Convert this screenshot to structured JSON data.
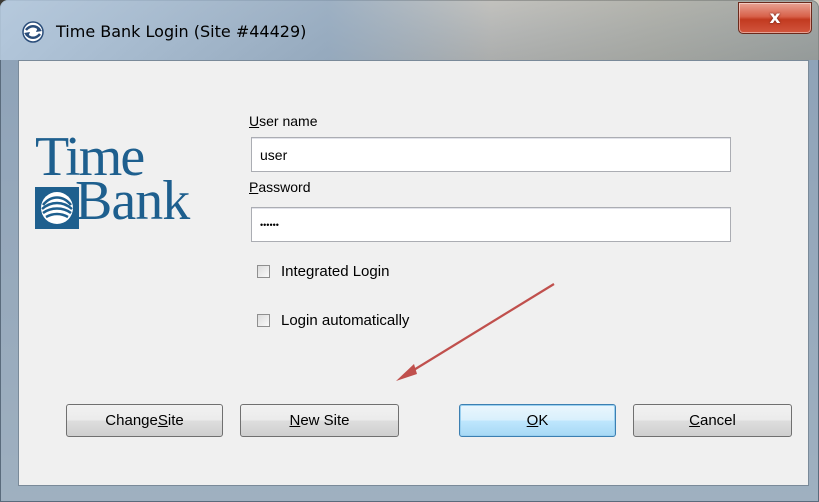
{
  "window": {
    "title": "Time Bank Login  (Site #44429)",
    "close_label": "x"
  },
  "logo": {
    "line1": "Time",
    "line2": "Bank",
    "brand_color": "#1e5f8e"
  },
  "form": {
    "username_label_underlined": "U",
    "username_label_rest": "ser name",
    "username_value": "user",
    "password_label_underlined": "P",
    "password_label_rest": "assword",
    "password_value": "••••••",
    "integrated_login_label": "Integrated Login",
    "integrated_login_checked": false,
    "login_auto_label": "Login automatically",
    "login_auto_checked": false
  },
  "buttons": {
    "change_site_pre": "Change ",
    "change_site_underlined": "S",
    "change_site_post": "ite",
    "new_site_underlined": "N",
    "new_site_post": "ew Site",
    "ok_underlined": "O",
    "ok_post": "K",
    "cancel_underlined": "C",
    "cancel_post": "ancel"
  },
  "annotation": {
    "arrow_color": "#c0504d"
  }
}
